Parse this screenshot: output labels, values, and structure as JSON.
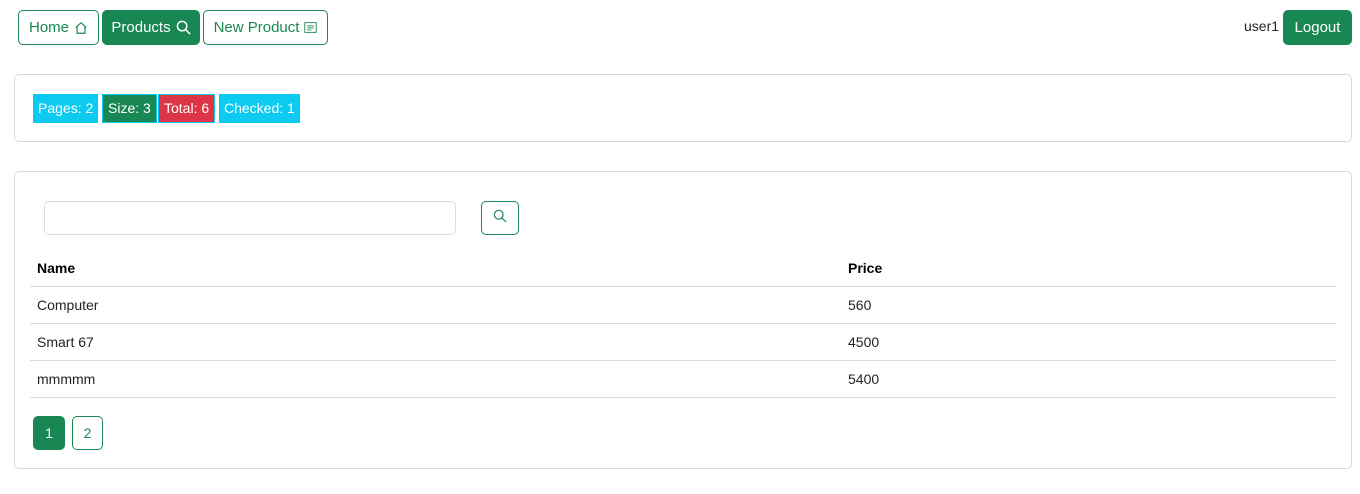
{
  "nav": {
    "home_label": "Home",
    "products_label": "Products",
    "new_product_label": "New Product",
    "user_name": "user1",
    "logout_label": "Logout"
  },
  "stats": {
    "pages": "Pages: 2",
    "size": "Size: 3",
    "total": "Total: 6",
    "checked": "Checked: 1"
  },
  "search": {
    "value": "",
    "placeholder": ""
  },
  "table": {
    "columns": [
      "Name",
      "Price"
    ],
    "rows": [
      {
        "name": "Computer",
        "price": "560"
      },
      {
        "name": "Smart 67",
        "price": "4500"
      },
      {
        "name": "mmmmm",
        "price": "5400"
      }
    ]
  },
  "pagination": {
    "pages": [
      "1",
      "2"
    ],
    "current": "1"
  },
  "colors": {
    "primary": "#198754",
    "info": "#0dcaf0",
    "danger": "#dc3545"
  },
  "icons": {
    "home": "home-icon",
    "products": "search-icon",
    "new_product": "form-icon",
    "search_button": "search-icon"
  }
}
